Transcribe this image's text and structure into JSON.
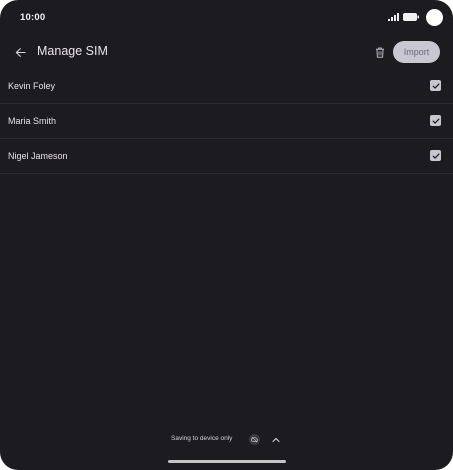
{
  "status_bar": {
    "time": "10:00",
    "icons": [
      "signal-icon",
      "battery-icon",
      "camera-cutout"
    ]
  },
  "app_bar": {
    "back_icon": "arrow-left-icon",
    "title": "Manage SIM",
    "delete_icon": "trash-icon",
    "import_label": "Import"
  },
  "contacts": [
    {
      "name": "Kevin Foley",
      "checked": true
    },
    {
      "name": "Maria Smith",
      "checked": true
    },
    {
      "name": "Nigel Jameson",
      "checked": true
    }
  ],
  "storage": {
    "label": "Saving to device only",
    "cloud_icon": "cloud-off-icon",
    "expand_icon": "chevron-up-icon"
  },
  "colors": {
    "background": "#1c1b1f",
    "text": "#e6e1e5",
    "import_button": "#c9c7d2",
    "checkbox": "#c8c6cf",
    "divider": "#2b2a2e"
  }
}
